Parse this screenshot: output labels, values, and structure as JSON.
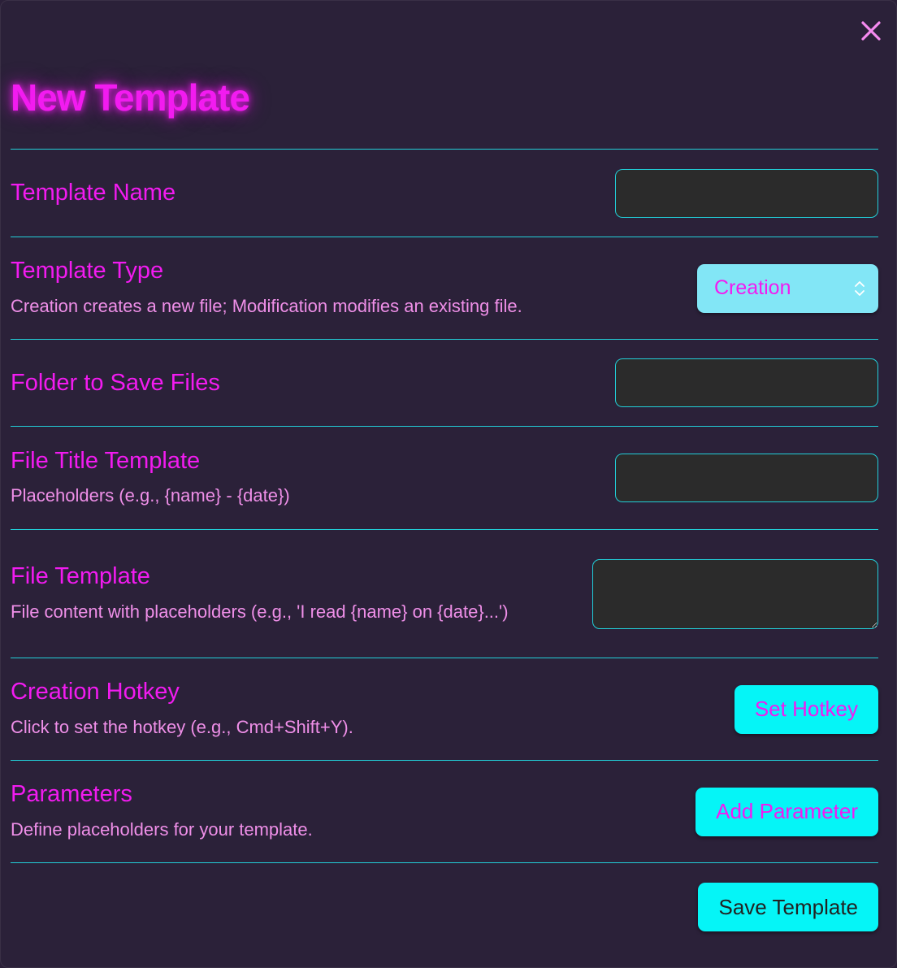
{
  "modal": {
    "title": "New Template",
    "close_icon": "close-icon"
  },
  "colors": {
    "background": "#2b2139",
    "accent_magenta": "#f21bf0",
    "accent_cyan": "#05f5f7",
    "divider": "#22cfd8",
    "description": "#ef8fe8"
  },
  "fields": {
    "template_name": {
      "label": "Template Name",
      "value": ""
    },
    "template_type": {
      "label": "Template Type",
      "description": "Creation creates a new file; Modification modifies an existing file.",
      "selected": "Creation"
    },
    "folder": {
      "label": "Folder to Save Files",
      "value": ""
    },
    "file_title": {
      "label": "File Title Template",
      "description": "Placeholders (e.g., {name} - {date})",
      "value": ""
    },
    "file_template": {
      "label": "File Template",
      "description": "File content with placeholders (e.g., 'I read {name} on {date}...')",
      "value": ""
    },
    "hotkey": {
      "label": "Creation Hotkey",
      "description": "Click to set the hotkey (e.g., Cmd+Shift+Y).",
      "button": "Set Hotkey"
    },
    "parameters": {
      "label": "Parameters",
      "description": "Define placeholders for your template.",
      "button": "Add Parameter"
    }
  },
  "footer": {
    "save_label": "Save Template"
  }
}
